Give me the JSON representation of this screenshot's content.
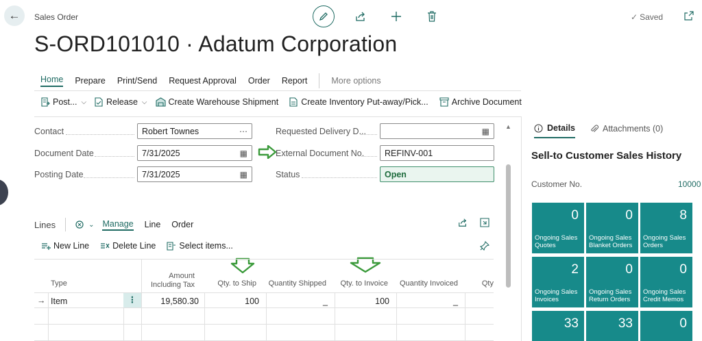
{
  "header": {
    "breadcrumb": "Sales Order",
    "title": "S-ORD101010 · Adatum Corporation",
    "saved_label": "Saved"
  },
  "tabs": {
    "home": "Home",
    "prepare": "Prepare",
    "print_send": "Print/Send",
    "request_approval": "Request Approval",
    "order": "Order",
    "report": "Report",
    "more": "More options"
  },
  "toolbar": {
    "post": "Post...",
    "release": "Release",
    "warehouse_shipment": "Create Warehouse Shipment",
    "inventory_putaway": "Create Inventory Put-away/Pick...",
    "archive": "Archive Document"
  },
  "fields": {
    "contact_label": "Contact",
    "contact_value": "Robert Townes",
    "document_date_label": "Document Date",
    "document_date_value": "7/31/2025",
    "posting_date_label": "Posting Date",
    "posting_date_value": "7/31/2025",
    "requested_delivery_label": "Requested Delivery D...",
    "requested_delivery_value": "",
    "external_doc_label": "External Document No.",
    "external_doc_value": "REFINV-001",
    "status_label": "Status",
    "status_value": "Open"
  },
  "lines": {
    "title": "Lines",
    "manage": "Manage",
    "line": "Line",
    "order": "Order",
    "new_line": "New Line",
    "delete_line": "Delete Line",
    "select_items": "Select items...",
    "columns": {
      "type": "Type",
      "amount_line1": "Amount",
      "amount_line2": "Including Tax",
      "qty_to_ship": "Qty. to Ship",
      "quantity_shipped": "Quantity Shipped",
      "qty_to_invoice": "Qty. to Invoice",
      "quantity_invoiced": "Quantity Invoiced",
      "qty": "Qty"
    },
    "rows": [
      {
        "type": "Item",
        "amount": "19,580.30",
        "qty_to_ship": "100",
        "quantity_shipped": "_",
        "qty_to_invoice": "100",
        "quantity_invoiced": "_"
      }
    ]
  },
  "factbox": {
    "details_tab": "Details",
    "attachments_tab": "Attachments (0)",
    "title": "Sell-to Customer Sales History",
    "customer_no_label": "Customer No.",
    "customer_no_value": "10000",
    "tiles": [
      {
        "value": "0",
        "line1": "Ongoing Sales",
        "line2": "Quotes"
      },
      {
        "value": "0",
        "line1": "Ongoing Sales",
        "line2": "Blanket Orders"
      },
      {
        "value": "8",
        "line1": "Ongoing Sales",
        "line2": "Orders"
      },
      {
        "value": "2",
        "line1": "Ongoing Sales",
        "line2": "Invoices"
      },
      {
        "value": "0",
        "line1": "Ongoing Sales",
        "line2": "Return Orders"
      },
      {
        "value": "0",
        "line1": "Ongoing Sales",
        "line2": "Credit Memos"
      },
      {
        "value": "33",
        "line1": "",
        "line2": ""
      },
      {
        "value": "33",
        "line1": "",
        "line2": ""
      },
      {
        "value": "0",
        "line1": "",
        "line2": ""
      }
    ]
  },
  "colors": {
    "accent": "#1f6b63",
    "tile": "#178a8a",
    "annotation_arrow": "#3a9a3a"
  }
}
